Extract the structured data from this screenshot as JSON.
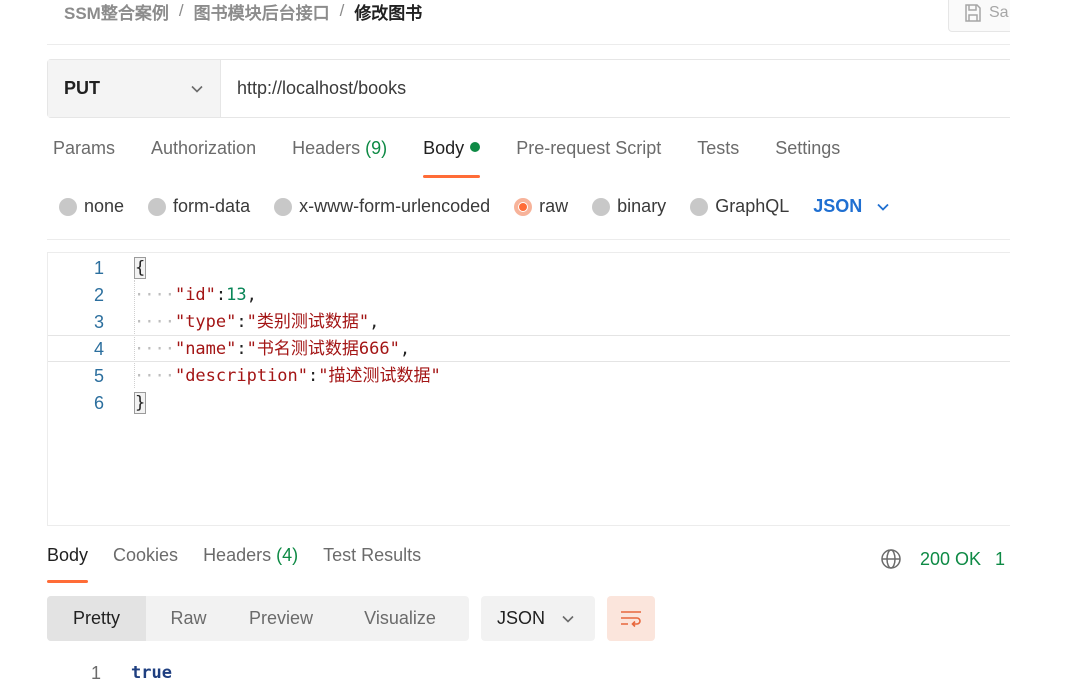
{
  "breadcrumb": {
    "items": [
      "SSM整合案例",
      "图书模块后台接口"
    ],
    "separator": "/",
    "current": "修改图书"
  },
  "save_button": {
    "label": "Sa"
  },
  "request": {
    "method": "PUT",
    "url": "http://localhost/books"
  },
  "request_tabs": [
    {
      "label": "Params"
    },
    {
      "label": "Authorization"
    },
    {
      "label": "Headers",
      "count": "(9)"
    },
    {
      "label": "Body",
      "active": true
    },
    {
      "label": "Pre-request Script"
    },
    {
      "label": "Tests"
    },
    {
      "label": "Settings"
    }
  ],
  "body_types": {
    "options": [
      "none",
      "form-data",
      "x-www-form-urlencoded",
      "raw",
      "binary",
      "GraphQL"
    ],
    "selected": "raw",
    "format": "JSON"
  },
  "editor": {
    "lines": [
      {
        "n": "1",
        "open": "{"
      },
      {
        "n": "2",
        "key": "\"id\"",
        "value": "13",
        "value_type": "num",
        "comma": ","
      },
      {
        "n": "3",
        "key": "\"type\"",
        "value": "\"类别测试数据\"",
        "value_type": "str",
        "comma": ","
      },
      {
        "n": "4",
        "key": "\"name\"",
        "value": "\"书名测试数据666\"",
        "value_type": "str",
        "comma": ","
      },
      {
        "n": "5",
        "key": "\"description\"",
        "value": "\"描述测试数据\"",
        "value_type": "str",
        "comma": ""
      },
      {
        "n": "6",
        "close": "}"
      }
    ]
  },
  "response_tabs": [
    {
      "label": "Body",
      "active": true
    },
    {
      "label": "Cookies"
    },
    {
      "label": "Headers",
      "count": "(4)"
    },
    {
      "label": "Test Results"
    }
  ],
  "status": {
    "code": "200 OK",
    "extra": "1"
  },
  "view_modes": [
    {
      "label": "Pretty",
      "selected": true
    },
    {
      "label": "Raw"
    },
    {
      "label": "Preview"
    },
    {
      "label": "Visualize"
    }
  ],
  "response_format": "JSON",
  "response_body": {
    "line_number": "1",
    "text": "true"
  },
  "colors": {
    "accent": "#ff6c37",
    "success": "#0e8a45",
    "link": "#1f6fd1"
  }
}
